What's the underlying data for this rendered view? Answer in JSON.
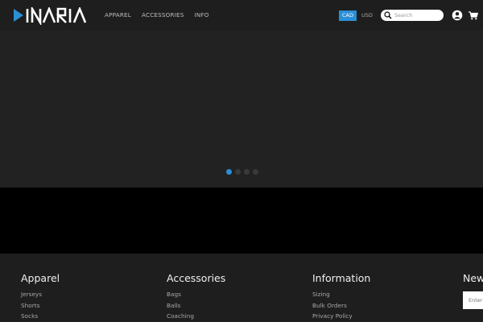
{
  "header": {
    "logo_text": "INARIA",
    "nav": [
      "APPAREL",
      "ACCESSORIES",
      "INFO"
    ],
    "currency": {
      "active": "CAD",
      "inactive": "USD"
    },
    "search_placeholder": "Search"
  },
  "slider": {
    "slides": 4,
    "active_index": 0
  },
  "footer": {
    "columns": [
      {
        "title": "Apparel",
        "links": [
          "Jerseys",
          "Shorts",
          "Socks"
        ]
      },
      {
        "title": "Accessories",
        "links": [
          "Bags",
          "Balls",
          "Coaching"
        ]
      },
      {
        "title": "Information",
        "links": [
          "Sizing",
          "Bulk Orders",
          "Privacy Policy"
        ]
      },
      {
        "title": "New",
        "links": []
      }
    ],
    "newsletter_placeholder": "Enter"
  },
  "colors": {
    "accent": "#2b8fd6",
    "header_bg": "#1e1e1e",
    "hero_bg": "#222222"
  }
}
